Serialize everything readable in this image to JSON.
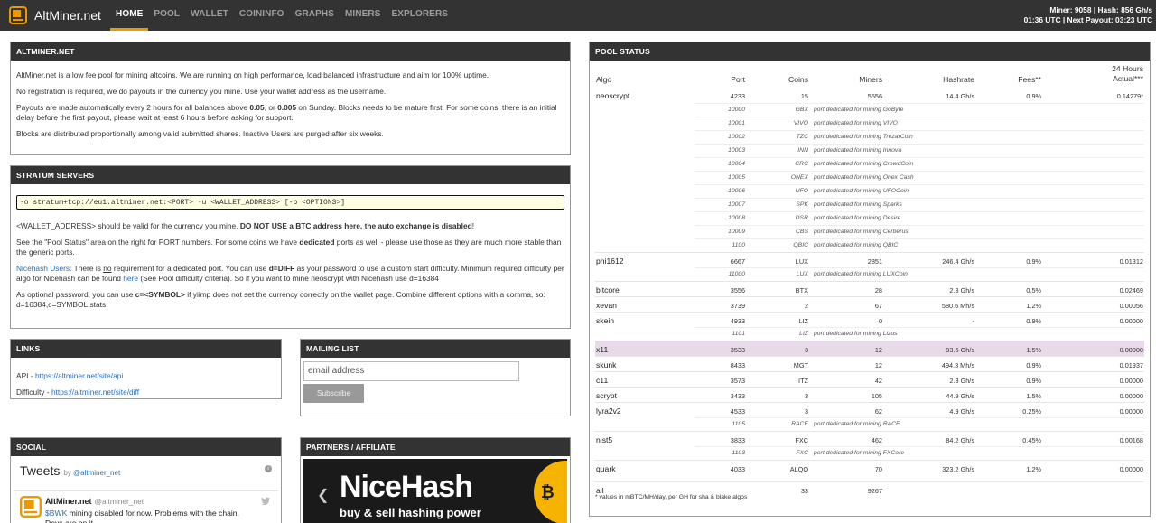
{
  "navbar": {
    "brand": "AltMiner.net",
    "items": [
      "HOME",
      "POOL",
      "WALLET",
      "COININFO",
      "GRAPHS",
      "MINERS",
      "EXPLORERS"
    ],
    "active_index": 0,
    "status_line1": "Miner: 9058 | Hash: 856 Gh/s",
    "status_line2": "01:36 UTC | Next Payout: 03:23 UTC"
  },
  "about": {
    "title": "ALTMINER.NET",
    "p1": "AltMiner.net is a low fee pool for mining altcoins. We are running on high performance, load balanced infrastructure and aim for 100% uptime.",
    "p2": "No registration is required, we do payouts in the currency you mine. Use your wallet address as the username.",
    "p3_a": "Payouts are made automatically every 2 hours for all balances above ",
    "p3_b": "0.05",
    "p3_c": ", or ",
    "p3_d": "0.005",
    "p3_e": " on Sunday. Blocks needs to be mature first. For some coins, there is an initial delay before the first payout, please wait at least 6 hours before asking for support.",
    "p4": "Blocks are distributed proportionally among valid submitted shares. Inactive Users are purged after six weeks."
  },
  "stratum": {
    "title": "STRATUM SERVERS",
    "command": "-o stratum+tcp://eu1.altminer.net:<PORT> -u <WALLET_ADDRESS> [-p <OPTIONS>]",
    "p1_a": "<WALLET_ADDRESS> should be valid for the currency you mine. ",
    "p1_b": "DO NOT USE a BTC address here, the auto exchange is disabled",
    "p1_c": "!",
    "p2_a": "See the \"Pool Status\" area on the right for PORT numbers. For some coins we have ",
    "p2_b": "dedicated",
    "p2_c": " ports as well - please use those as they are much more stable than the generic ports.",
    "p3_label": "Nicehash Users:",
    "p3_a": " There is ",
    "p3_no": "no",
    "p3_b": " requirement for a dedicated port. You can use ",
    "p3_diff": "d=DIFF",
    "p3_c": " as your password to use a custom start difficulty. Minimum required difficulty per algo for Nicehash can be found ",
    "p3_here": "here",
    "p3_d": " (See Pool difficulty criteria). So if you want to mine neoscrypt with Nicehash use d=16384",
    "p4_a": "As optional password, you can use ",
    "p4_b": "c=<SYMBOL>",
    "p4_c": " if yiimp does not set the currency correctly on the wallet page. Combine different options with a comma, so: d=16384,c=SYMBOL,stats"
  },
  "links": {
    "title": "LINKS",
    "api_label": "API - ",
    "api_url": "https://altminer.net/site/api",
    "diff_label": "Difficulty - ",
    "diff_url": "https://altminer.net/site/diff"
  },
  "mailing": {
    "title": "MAILING LIST",
    "placeholder": "email address",
    "button": "Subscribe"
  },
  "social": {
    "title": "SOCIAL",
    "tweets": "Tweets",
    "by": "by ",
    "by_handle": "@altminer_net",
    "author": "AltMiner.net",
    "handle": "@altminer_net",
    "tweet_tag": "$BWK",
    "tweet_text": " mining disabled for now. Problems with the chain. Devs are on it."
  },
  "partners": {
    "title": "PARTNERS / AFFILIATE",
    "banner_title": "NiceHash",
    "banner_sub": "buy & sell hashing power"
  },
  "pool": {
    "title": "POOL STATUS",
    "headers": {
      "algo": "Algo",
      "port": "Port",
      "coins": "Coins",
      "miners": "Miners",
      "hashrate": "Hashrate",
      "fees": "Fees**",
      "actual1": "24 Hours",
      "actual2": "Actual***"
    },
    "rows": [
      {
        "type": "main",
        "algo": "neoscrypt",
        "port": "4233",
        "coins": "15",
        "miners": "5556",
        "hashrate": "14.4 Gh/s",
        "fees": "0.9%",
        "actual": "0.14279*"
      },
      {
        "type": "sub",
        "port": "10000",
        "sym": "GBX",
        "desc": "port dedicated for mining GoByte"
      },
      {
        "type": "sub",
        "port": "10001",
        "sym": "VIVO",
        "desc": "port dedicated for mining VIVO"
      },
      {
        "type": "sub",
        "port": "10002",
        "sym": "TZC",
        "desc": "port dedicated for mining TrezarCoin"
      },
      {
        "type": "sub",
        "port": "10003",
        "sym": "INN",
        "desc": "port dedicated for mining Innova"
      },
      {
        "type": "sub",
        "port": "10004",
        "sym": "CRC",
        "desc": "port dedicated for mining CrowdCoin"
      },
      {
        "type": "sub",
        "port": "10005",
        "sym": "ONEX",
        "desc": "port dedicated for mining Onex Cash"
      },
      {
        "type": "sub",
        "port": "10006",
        "sym": "UFO",
        "desc": "port dedicated for mining UFOCoin"
      },
      {
        "type": "sub",
        "port": "10007",
        "sym": "SPK",
        "desc": "port dedicated for mining Sparks"
      },
      {
        "type": "sub",
        "port": "10008",
        "sym": "DSR",
        "desc": "port dedicated for mining Desire"
      },
      {
        "type": "sub",
        "port": "10009",
        "sym": "CBS",
        "desc": "port dedicated for mining Cerberus"
      },
      {
        "type": "sub",
        "port": "1100",
        "sym": "QBIC",
        "desc": "port dedicated for mining QBIC"
      },
      {
        "type": "main",
        "algo": "phi1612",
        "port": "6667",
        "coins": "LUX",
        "miners": "2851",
        "hashrate": "246.4 Gh/s",
        "fees": "0.9%",
        "actual": "0.01312"
      },
      {
        "type": "sub",
        "port": "11000",
        "sym": "LUX",
        "desc": "port dedicated for mining LUXCoin"
      },
      {
        "type": "main",
        "algo": "bitcore",
        "port": "3556",
        "coins": "BTX",
        "miners": "28",
        "hashrate": "2.3 Gh/s",
        "fees": "0.5%",
        "actual": "0.02469"
      },
      {
        "type": "main",
        "algo": "xevan",
        "port": "3739",
        "coins": "2",
        "miners": "67",
        "hashrate": "580.6 Mh/s",
        "fees": "1.2%",
        "actual": "0.00056"
      },
      {
        "type": "main",
        "algo": "skein",
        "port": "4933",
        "coins": "LIZ",
        "miners": "0",
        "hashrate": "-",
        "fees": "0.9%",
        "actual": "0.00000"
      },
      {
        "type": "sub",
        "port": "1101",
        "sym": "LIZ",
        "desc": "port dedicated for mining Lizus"
      },
      {
        "type": "main",
        "algo": "x11",
        "port": "3533",
        "coins": "3",
        "miners": "12",
        "hashrate": "93.6 Gh/s",
        "fees": "1.5%",
        "actual": "0.00000",
        "highlight": true
      },
      {
        "type": "main",
        "algo": "skunk",
        "port": "8433",
        "coins": "MGT",
        "miners": "12",
        "hashrate": "494.3 Mh/s",
        "fees": "0.9%",
        "actual": "0.01937"
      },
      {
        "type": "main",
        "algo": "c11",
        "port": "3573",
        "coins": "ITZ",
        "miners": "42",
        "hashrate": "2.3 Gh/s",
        "fees": "0.9%",
        "actual": "0.00000"
      },
      {
        "type": "main",
        "algo": "scrypt",
        "port": "3433",
        "coins": "3",
        "miners": "105",
        "hashrate": "44.9 Gh/s",
        "fees": "1.5%",
        "actual": "0.00000"
      },
      {
        "type": "main",
        "algo": "lyra2v2",
        "port": "4533",
        "coins": "3",
        "miners": "62",
        "hashrate": "4.9 Gh/s",
        "fees": "0.25%",
        "actual": "0.00000"
      },
      {
        "type": "sub",
        "port": "1105",
        "sym": "RACE",
        "desc": "port dedicated for mining RACE"
      },
      {
        "type": "main",
        "algo": "nist5",
        "port": "3833",
        "coins": "FXC",
        "miners": "462",
        "hashrate": "84.2 Gh/s",
        "fees": "0.45%",
        "actual": "0.00168"
      },
      {
        "type": "sub",
        "port": "1103",
        "sym": "FXC",
        "desc": "port dedicated for mining FXCore"
      },
      {
        "type": "main",
        "algo": "quark",
        "port": "4033",
        "coins": "ALQO",
        "miners": "70",
        "hashrate": "323.2 Gh/s",
        "fees": "1.2%",
        "actual": "0.00000",
        "tall": true
      },
      {
        "type": "main",
        "algo": "all",
        "port": "",
        "coins": "33",
        "miners": "9267",
        "hashrate": "",
        "fees": "",
        "actual": ""
      }
    ],
    "note": "* values in mBTC/MH/day, per GH for sha & blake algos"
  }
}
